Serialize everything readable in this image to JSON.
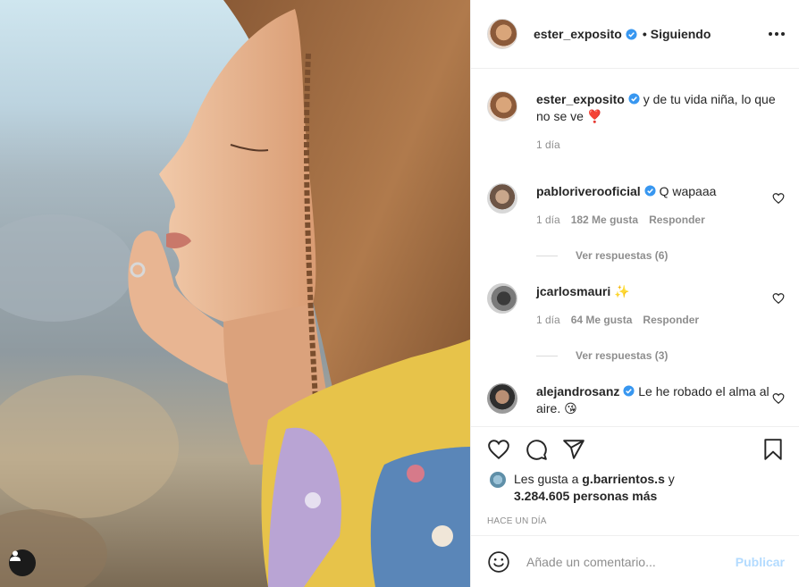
{
  "post_header": {
    "username": "ester_exposito",
    "separator": "•",
    "follow_status": "Siguiendo"
  },
  "caption": {
    "username": "ester_exposito",
    "text": "y de tu vida niña, lo que no se ve ❣️",
    "time": "1 día"
  },
  "comments": [
    {
      "username": "pablorivero​oficial",
      "verified": true,
      "text": "Q wapaaa",
      "time": "1 día",
      "likes": "182 Me gusta",
      "reply": "Responder",
      "view_replies": "Ver respuestas (6)"
    },
    {
      "username": "jcarlosmauri",
      "verified": false,
      "text": "✨",
      "time": "1 día",
      "likes": "64 Me gusta",
      "reply": "Responder",
      "view_replies": "Ver respuestas (3)"
    },
    {
      "username": "alejandrosanz",
      "verified": true,
      "text": "Le he robado el alma al aire. 😘"
    }
  ],
  "likes": {
    "prefix": "Les gusta a",
    "user": "g.barrientos.s",
    "conj": "y",
    "count": "3.284.605 personas más"
  },
  "timestamp": "HACE UN DÍA",
  "add_comment": {
    "placeholder": "Añade un comentario...",
    "publish": "Publicar"
  },
  "icons": {
    "verified": "verified-badge-icon",
    "more": "more-options-icon",
    "like": "heart-icon",
    "comment": "comment-icon",
    "share": "share-icon",
    "save": "bookmark-icon",
    "emoji": "emoji-icon",
    "user_tag": "user-tag-icon"
  },
  "colors": {
    "verified_blue": "#3897f0",
    "publish_disabled": "#b3dbff",
    "muted": "#8e8e8e"
  }
}
